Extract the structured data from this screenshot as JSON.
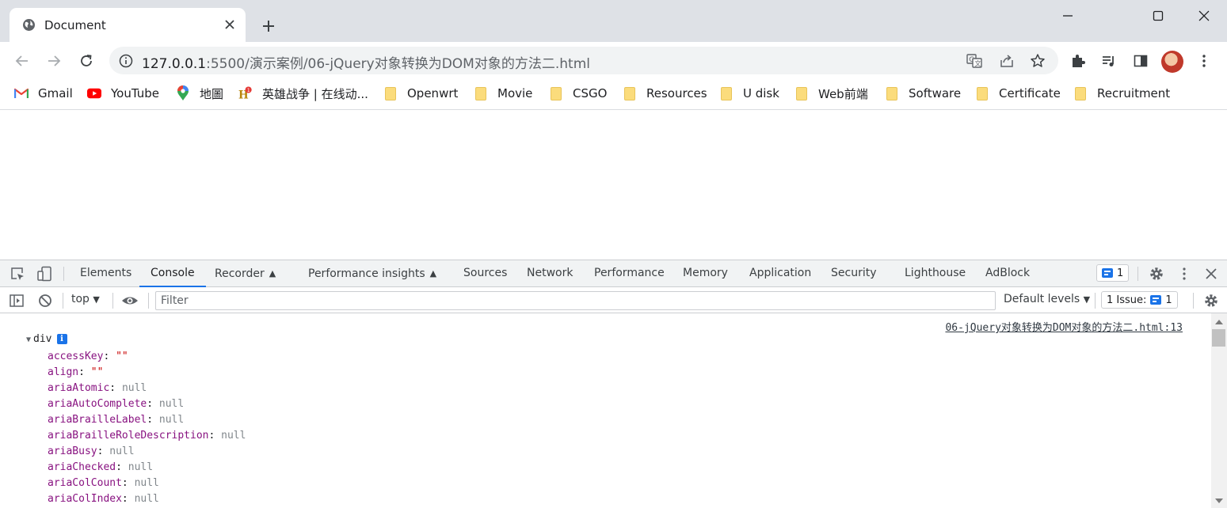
{
  "window": {
    "tab_title": "Document",
    "controls": [
      "minimize",
      "maximize",
      "close"
    ]
  },
  "toolbar": {
    "url_host": "127.0.0.1",
    "url_rest": ":5500/演示案例/06-jQuery对象转换为DOM对象的方法二.html"
  },
  "bookmarks": [
    {
      "label": "Gmail",
      "icon": "gmail-icon"
    },
    {
      "label": "YouTube",
      "icon": "youtube-icon"
    },
    {
      "label": "地圖",
      "icon": "maps-pin-icon"
    },
    {
      "label": "英雄战争 | 在线动...",
      "icon": "game-icon"
    },
    {
      "label": "Openwrt",
      "icon": "folder-icon"
    },
    {
      "label": "Movie",
      "icon": "folder-icon"
    },
    {
      "label": "CSGO",
      "icon": "folder-icon"
    },
    {
      "label": "Resources",
      "icon": "folder-icon"
    },
    {
      "label": "U disk",
      "icon": "folder-icon"
    },
    {
      "label": "Web前端",
      "icon": "folder-icon"
    },
    {
      "label": "Software",
      "icon": "folder-icon"
    },
    {
      "label": "Certificate",
      "icon": "folder-icon"
    },
    {
      "label": "Recruitment",
      "icon": "folder-icon"
    }
  ],
  "devtools": {
    "tabs": [
      "Elements",
      "Console",
      "Recorder",
      "Performance insights",
      "Sources",
      "Network",
      "Performance",
      "Memory",
      "Application",
      "Security",
      "Lighthouse",
      "AdBlock"
    ],
    "active_tab": "Console",
    "messages_badge": "1",
    "console": {
      "context": "top",
      "filter_placeholder": "Filter",
      "levels": "Default levels",
      "issues": "1 Issue:",
      "issues_count": "1",
      "source_link": "06-jQuery对象转换为DOM对象的方法二.html:13",
      "object_label": "div",
      "properties": [
        {
          "key": "accessKey",
          "value": "\"\"",
          "type": "string"
        },
        {
          "key": "align",
          "value": "\"\"",
          "type": "string"
        },
        {
          "key": "ariaAtomic",
          "value": "null",
          "type": "null"
        },
        {
          "key": "ariaAutoComplete",
          "value": "null",
          "type": "null"
        },
        {
          "key": "ariaBrailleLabel",
          "value": "null",
          "type": "null"
        },
        {
          "key": "ariaBrailleRoleDescription",
          "value": "null",
          "type": "null"
        },
        {
          "key": "ariaBusy",
          "value": "null",
          "type": "null"
        },
        {
          "key": "ariaChecked",
          "value": "null",
          "type": "null"
        },
        {
          "key": "ariaColCount",
          "value": "null",
          "type": "null"
        },
        {
          "key": "ariaColIndex",
          "value": "null",
          "type": "null"
        }
      ]
    }
  },
  "colors": {
    "accent": "#1a73e8",
    "prop_key": "#881280",
    "null_value": "#80868b",
    "string_value": "#c80000"
  }
}
